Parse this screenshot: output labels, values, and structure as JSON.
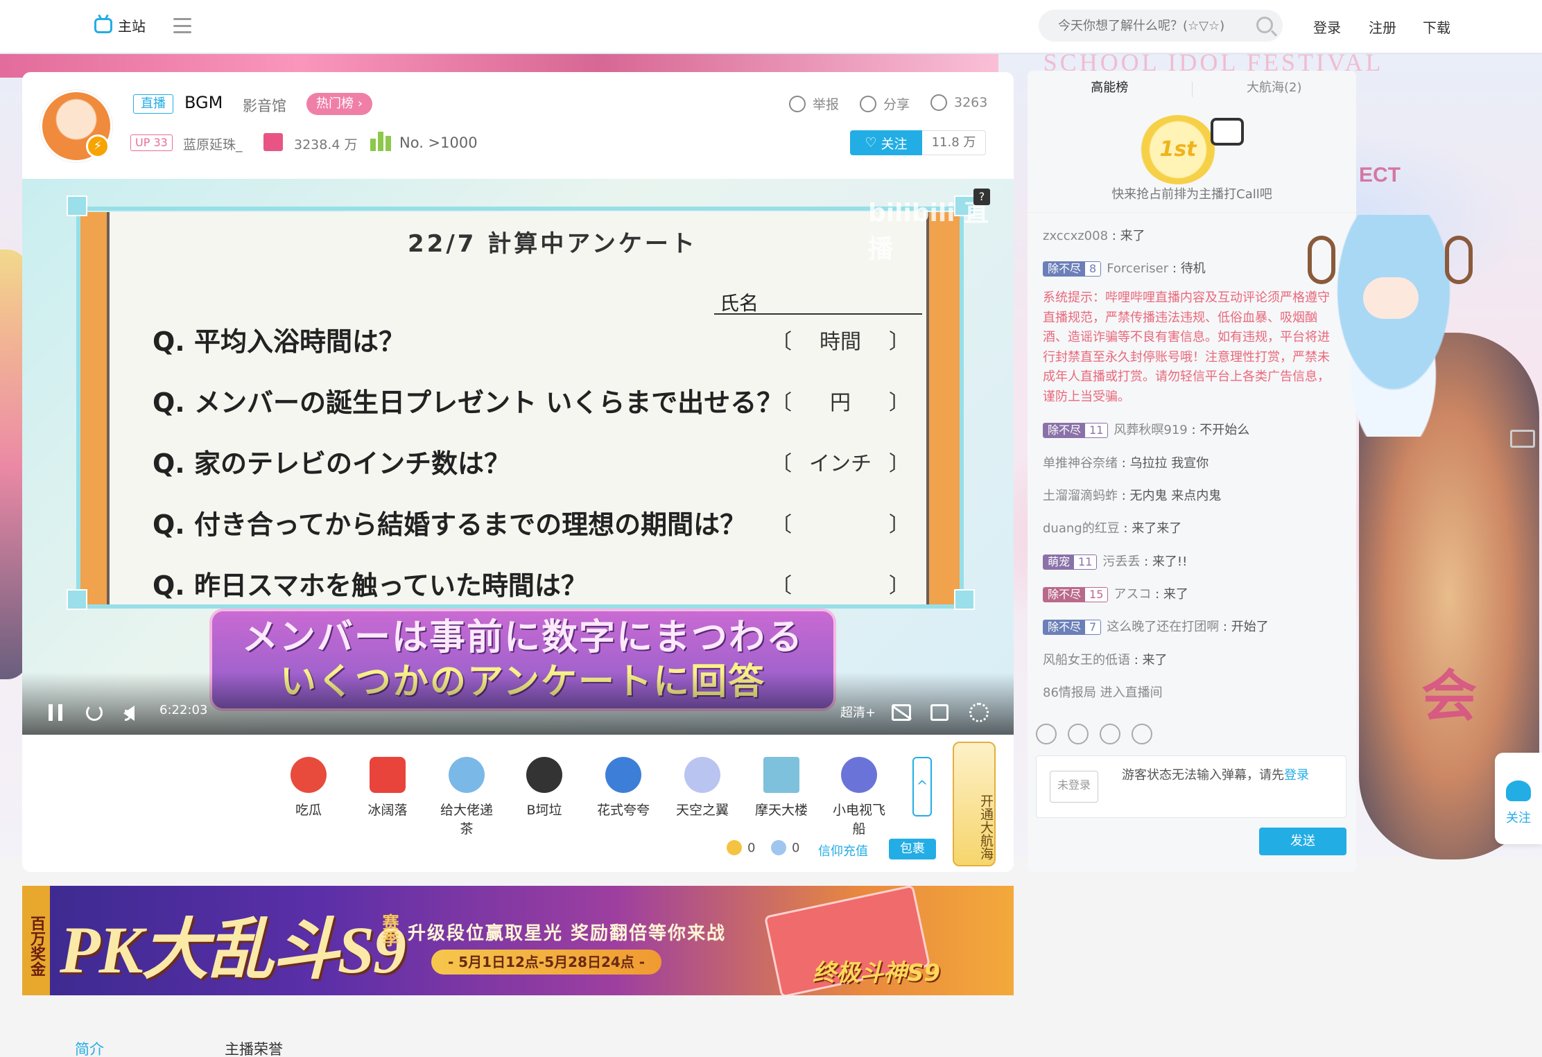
{
  "nav": {
    "home_label": "主站",
    "search_placeholder": "今天你想了解什么呢？(☆▽☆)",
    "login": "登录",
    "register": "注册",
    "download": "下载"
  },
  "background": {
    "banner_text": "SCHOOL IDOL FESTIVAL",
    "side_text": "ECT",
    "decor_text": "会"
  },
  "room": {
    "live_tag": "直播",
    "title": "BGM",
    "category": "影音馆",
    "hot_tag": "热门榜 ›",
    "report": "举报",
    "share": "分享",
    "viewers": "3263",
    "up_level": "UP 33",
    "up_name": "蓝原延珠_",
    "gift_value": "3238.4 万",
    "rank": "No. >1000",
    "follow": "关注",
    "followers": "11.8 万"
  },
  "video": {
    "doc_title": "22/7 計算中アンケート",
    "name_label": "氏名",
    "questions": [
      {
        "q": "Q. 平均入浴時間は？",
        "unit": "時間"
      },
      {
        "q": "Q. メンバーの誕生日プレゼント いくらまで出せる？",
        "unit": "円"
      },
      {
        "q": "Q. 家のテレビのインチ数は？",
        "unit": "インチ"
      },
      {
        "q": "Q. 付き合ってから結婚するまでの理想の期間は？",
        "unit": ""
      },
      {
        "q": "Q. 昨日スマホを触っていた時間は？",
        "unit": ""
      }
    ],
    "caption_line1": "メンバーは事前に数字にまつわる",
    "caption_line2": "いくつかのアンケートに回答",
    "watermark": "bilibili 直播",
    "help": "?",
    "time": "6:22:03",
    "quality": "超清+"
  },
  "gifts": [
    {
      "label": "吃瓜",
      "color": "#e84b3c"
    },
    {
      "label": "冰阔落",
      "color": "#e8443c"
    },
    {
      "label": "给大佬递茶",
      "color": "#7ab8e8"
    },
    {
      "label": "B坷垃",
      "color": "#333333"
    },
    {
      "label": "花式夸夸",
      "color": "#3d7fd8"
    },
    {
      "label": "天空之翼",
      "color": "#b9c4f0"
    },
    {
      "label": "摩天大楼",
      "color": "#7ec1dc"
    },
    {
      "label": "小电视飞船",
      "color": "#6a74d8"
    }
  ],
  "gift_more": "^",
  "guard_label": "开通大航海",
  "wallet": {
    "gold": "0",
    "silver": "0",
    "charge": "信仰充值",
    "pack": "包裹"
  },
  "ad": {
    "side_label": "百万奖金",
    "big_text": "PK大乱斗S9",
    "sai": "赛季",
    "sub": "升级段位赢取星光 奖励翻倍等你来战",
    "date": "- 5月1日12点-5月28日24点 -",
    "final": "终极斗神S9"
  },
  "bottom_tabs": {
    "intro": "简介",
    "honor": "主播荣誉"
  },
  "panel": {
    "tab_rank": "高能榜",
    "tab_guard": "大航海(2)",
    "call_badge": "1st",
    "call_text": "快来抢占前排为主播打Call吧",
    "chat": [
      {
        "medal": "",
        "level": "",
        "user": "zxccxz008",
        "msg": "来了",
        "color": ""
      },
      {
        "medal": "除不尽",
        "level": "8",
        "user": "Forceriser",
        "msg": "待机",
        "color": "#6b7fb8"
      },
      {
        "medal": "除不尽",
        "level": "11",
        "user": "风葬秋暝919",
        "msg": "不开始么",
        "color": "#8a72a8"
      },
      {
        "medal": "",
        "level": "",
        "user": "单推神谷奈绪",
        "msg": "乌拉拉 我宣你",
        "color": ""
      },
      {
        "medal": "",
        "level": "",
        "user": "土溜溜滴蚂蚱",
        "msg": "无内鬼 来点内鬼",
        "color": ""
      },
      {
        "medal": "",
        "level": "",
        "user": "duang的红豆",
        "msg": "来了来了",
        "color": ""
      },
      {
        "medal": "萌宠",
        "level": "11",
        "user": "污丢丢",
        "msg": "来了!!",
        "color": "#8a72a8"
      },
      {
        "medal": "除不尽",
        "level": "15",
        "user": "アスコ",
        "msg": "来了",
        "color": "#b96a8a"
      },
      {
        "medal": "除不尽",
        "level": "7",
        "user": "这么晚了还在打团啊",
        "msg": "开始了",
        "color": "#6b7fb8"
      },
      {
        "medal": "",
        "level": "",
        "user": "风船女王的低语",
        "msg": "来了",
        "color": ""
      }
    ],
    "system_msg": "系统提示：哔哩哔哩直播内容及互动评论须严格遵守直播规范，严禁传播违法违规、低俗血暴、吸烟酗酒、造谣诈骗等不良有害信息。如有违规，平台将进行封禁直至永久封停账号哦！注意理性打赏，严禁未成年人直播或打赏。请勿轻信平台上各类广告信息，谨防上当受骗。",
    "entry_msg": "86情报局 进入直播间",
    "guest_badge": "未登录",
    "guest_text": "游客状态无法输入弹幕，请先",
    "guest_login": "登录",
    "send": "发送"
  },
  "side_follow": "关注"
}
